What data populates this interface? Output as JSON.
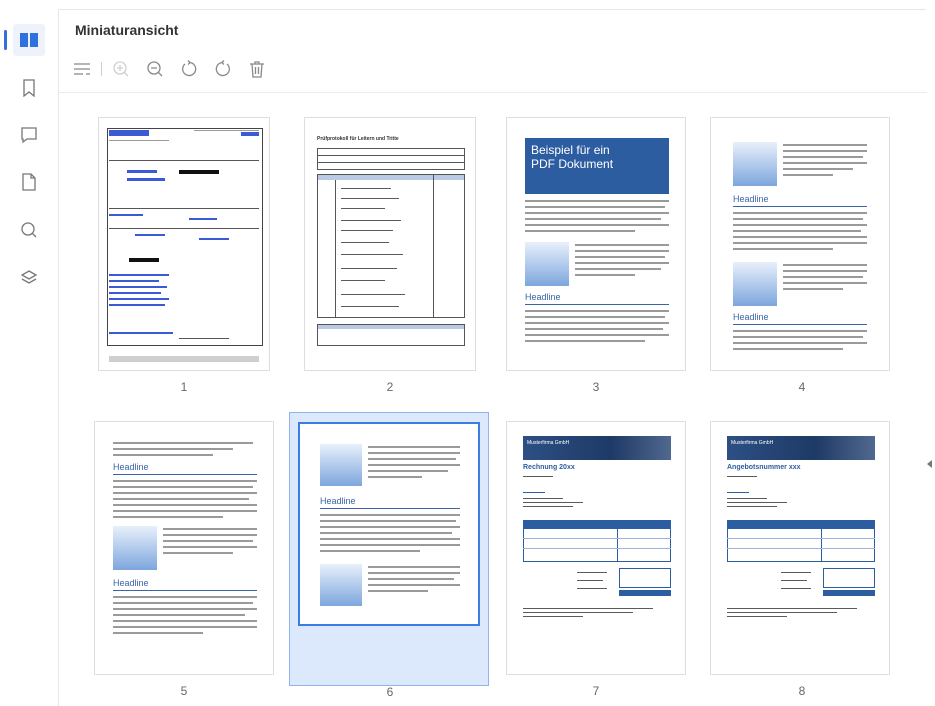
{
  "panel": {
    "title": "Miniaturansicht"
  },
  "icons": {
    "rail": [
      "thumbnails-icon",
      "bookmark-icon",
      "comment-icon",
      "attachment-icon",
      "search-icon",
      "layers-icon"
    ],
    "toolbar": [
      "options-icon",
      "zoom-in-icon",
      "zoom-out-icon",
      "rotate-left-icon",
      "rotate-right-icon",
      "delete-icon"
    ]
  },
  "pages": [
    {
      "number": "1"
    },
    {
      "number": "2",
      "heading": "Prüfprotokoll für Leitern und Tritte"
    },
    {
      "number": "3",
      "title_line1": "Beispiel für ein",
      "title_line2": "PDF Dokument",
      "headline": "Headline"
    },
    {
      "number": "4",
      "headline_1": "Headline",
      "headline_2": "Headline"
    },
    {
      "number": "5",
      "headline_1": "Headline",
      "headline_2": "Headline"
    },
    {
      "number": "6",
      "headline": "Headline"
    },
    {
      "number": "7",
      "banner": "Musterfirma GmbH",
      "title": "Rechnung 20xx"
    },
    {
      "number": "8",
      "banner": "Musterfirma GmbH",
      "title": "Angebotsnummer xxx"
    }
  ],
  "selected_page": "6",
  "colors": {
    "accent": "#2f6fde",
    "selection": "#dce8fb",
    "doc_blue": "#2d5da1"
  }
}
